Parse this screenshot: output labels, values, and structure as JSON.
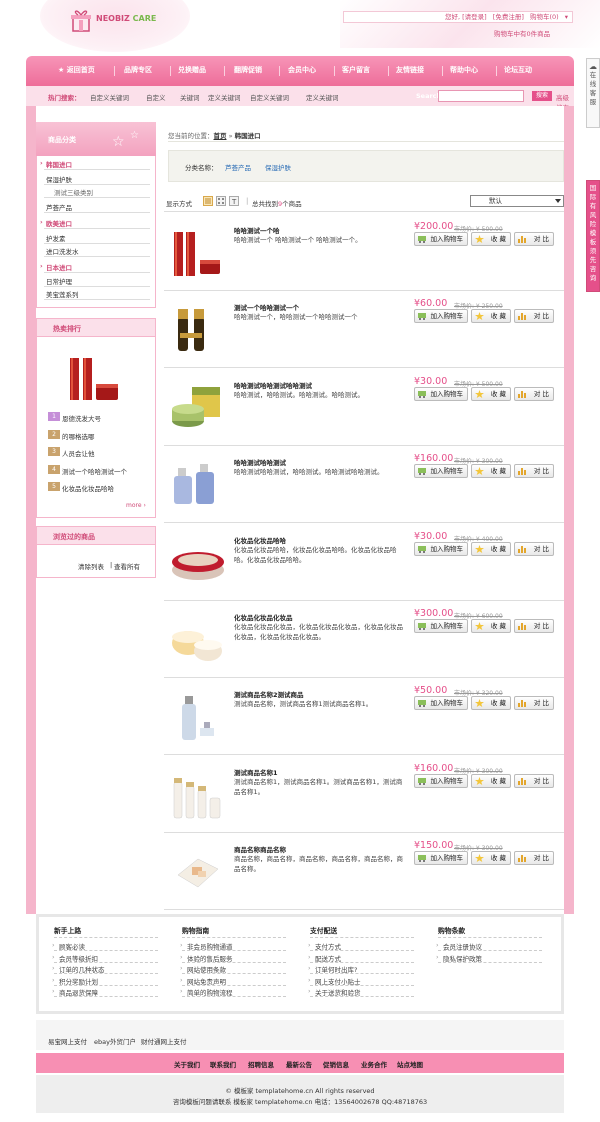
{
  "header": {
    "brand_a": "NEOBIZ",
    "brand_b": "CARE",
    "toplinks": [
      "您好, [请登录]",
      "[免费注册]",
      "购物车(0)"
    ],
    "cart_tip": "购物车中有0件商品"
  },
  "nav": {
    "items": [
      "★ 返回首页",
      "品牌专区",
      "兑换赠品",
      "翻牌促销",
      "会员中心",
      "客户留言",
      "友情链接",
      "帮助中心",
      "论坛互动"
    ]
  },
  "subnav": {
    "hot_label": "热门搜索：",
    "keywords": [
      "自定义关键词",
      "自定义",
      "关键词",
      "定义关键词",
      "自定义关键词",
      "定义关键词"
    ],
    "search_label": "Search",
    "search_button": "搜索",
    "advanced": "高级搜索"
  },
  "sidebar": {
    "category_title": "商品分类",
    "categories": [
      {
        "label": "韩国进口",
        "level": 1
      },
      {
        "label": "保湿护肤",
        "level": 2
      },
      {
        "label": "测试三级类别",
        "level": 3
      },
      {
        "label": "芦荟产品",
        "level": 2
      },
      {
        "label": "欧美进口",
        "level": 1
      },
      {
        "label": "护发素",
        "level": 2
      },
      {
        "label": "进口洗发水",
        "level": 2
      },
      {
        "label": "日本进口",
        "level": 1
      },
      {
        "label": "日常护理",
        "level": 2
      },
      {
        "label": "美宝莲系列",
        "level": 2
      }
    ],
    "hot_title": "热卖排行",
    "hot_items": [
      "恩德洗发大号",
      "的哪格选哪",
      "人员会让他",
      "测试一个哈哈测试一个",
      "化妆品化妆品哈哈"
    ],
    "more": "more ›",
    "viewed_title": "浏览过的商品",
    "viewed_links": [
      "清除列表",
      "查看所有"
    ]
  },
  "main": {
    "breadcrumb_prefix": "您当前的位置：",
    "breadcrumb_home": "首页",
    "breadcrumb_sep": "»",
    "breadcrumb_current": "韩国进口",
    "class_label": "分类名称：",
    "class_links": [
      "芦荟产品",
      "保湿护肤"
    ],
    "view_label": "显示方式",
    "count_text_a": "总共找到",
    "count_num": "9",
    "count_text_b": "个商品",
    "sort_selected": "默认",
    "btn_cart": "加入购物车",
    "btn_fav": "收 藏",
    "btn_compare": "对 比",
    "products": [
      {
        "title": "哈哈测试一个哈",
        "desc": "哈哈测试一个 哈哈测试一个 哈哈测试一个。",
        "price": "¥200.00",
        "market": "市场价: ¥ 500.00",
        "img": "tall-red"
      },
      {
        "title": "测试一个哈哈测试一个",
        "desc": "哈哈测试一个，哈哈测试一个哈哈测试一个",
        "price": "¥60.00",
        "market": "市场价: ¥ 250.00",
        "img": "gold-bottles"
      },
      {
        "title": "哈哈测试哈哈测试哈哈测试",
        "desc": "哈哈测试，哈哈测试。哈哈测试。哈哈测试。",
        "price": "¥30.00",
        "market": "市场价: ¥ 500.00",
        "img": "green-jar"
      },
      {
        "title": "哈哈测试哈哈测试",
        "desc": "哈哈测试哈哈测试，哈哈测试。哈哈测试哈哈测试。",
        "price": "¥160.00",
        "market": "市场价: ¥ 300.00",
        "img": "blue-bottles"
      },
      {
        "title": "化妆品化妆品哈哈",
        "desc": "化妆品化妆品哈哈，化妆品化妆品哈哈。化妆品化妆品哈哈。化妆品化妆品哈哈。",
        "price": "¥30.00",
        "market": "市场价: ¥ 400.00",
        "img": "compact"
      },
      {
        "title": "化妆品化妆品化妆品",
        "desc": "化妆品化妆品化妆品，化妆品化妆品化妆品，化妆品化妆品化妆品，化妆品化妆品化妆品。",
        "price": "¥300.00",
        "market": "市场价: ¥ 600.00",
        "img": "cream-jars"
      },
      {
        "title": "测试商品名称2测试商品",
        "desc": "测试商品名称，测试商品名称1测试商品名称1。",
        "price": "¥50.00",
        "market": "市场价: ¥ 320.00",
        "img": "clear-bottle"
      },
      {
        "title": "测试商品名称1",
        "desc": "测试商品名称1，测试商品名称1。测试商品名称1，测试商品名称1。",
        "price": "¥160.00",
        "market": "市场价: ¥ 300.00",
        "img": "white-set"
      },
      {
        "title": "商品名称商品名称",
        "desc": "商品名称，商品名称，商品名称，商品名称，商品名称，商品名称。",
        "price": "¥150.00",
        "market": "市场价: ¥ 300.00",
        "img": "palette"
      }
    ]
  },
  "footer": {
    "columns": [
      {
        "title": "新手上路",
        "links": [
          "顾客必读",
          "会员等级折扣",
          "订单的几种状态",
          "积分奖励计划",
          "商品退货保障"
        ]
      },
      {
        "title": "购物指南",
        "links": [
          "非会员购物通道",
          "体验的售后服务",
          "网站使用条款",
          "网站免责声明",
          "简单的购物流程"
        ]
      },
      {
        "title": "支付配送",
        "links": [
          "支付方式",
          "配送方式",
          "订单何时出库?",
          "网上支付小贴士",
          "关于送货和验货"
        ]
      },
      {
        "title": "购物条款",
        "links": [
          "会员注册协议",
          "隐私保护政策"
        ]
      }
    ],
    "pay_links": [
      "易宝网上支付",
      "ebay外贸门户",
      "财付通网上支付"
    ],
    "bottom_nav": [
      "关于我们",
      "联系我们",
      "招聘信息",
      "最新公告",
      "促销信息",
      "业务合作",
      "站点地图"
    ],
    "copyright": "© 模板家 templatehome.cn All rights reserved",
    "contact": "咨询模板问题请联系 模板家 templatehome.cn 电话：13564002678 QQ:48718763"
  },
  "side_tabs": {
    "online": "在线客服",
    "ad": "国际有风险模板须先咨询"
  }
}
